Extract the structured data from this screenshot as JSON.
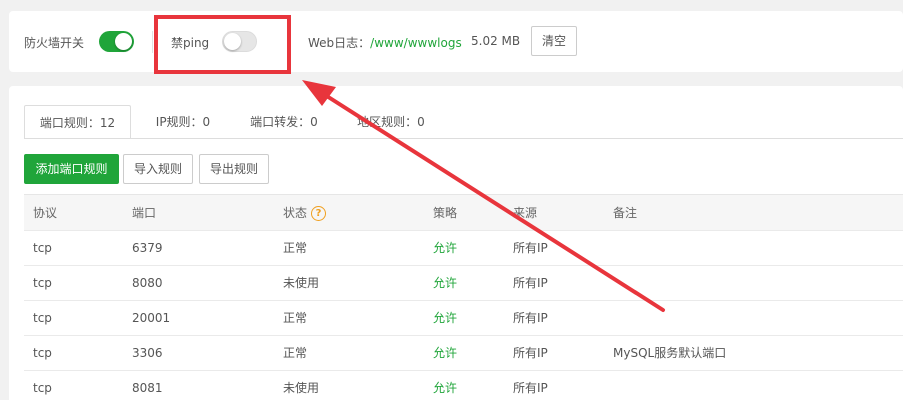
{
  "firewall": {
    "label": "防火墙开关",
    "on": true
  },
  "ping": {
    "label": "禁ping",
    "on": false
  },
  "weblog": {
    "label": "Web日志：",
    "path": "/www/wwwlogs",
    "size": "5.02 MB",
    "clear_label": "清空"
  },
  "tabs": [
    {
      "label": "端口规则：12",
      "active": true
    },
    {
      "label": "IP规则：0",
      "active": false
    },
    {
      "label": "端口转发：0",
      "active": false
    },
    {
      "label": "地区规则：0",
      "active": false
    }
  ],
  "actions": {
    "add_label": "添加端口规则",
    "import_label": "导入规则",
    "export_label": "导出规则"
  },
  "table": {
    "headers": {
      "protocol": "协议",
      "port": "端口",
      "status": "状态",
      "policy": "策略",
      "source": "来源",
      "remark": "备注"
    },
    "rows": [
      {
        "protocol": "tcp",
        "port": "6379",
        "status": "正常",
        "policy": "允许",
        "source": "所有IP",
        "remark": ""
      },
      {
        "protocol": "tcp",
        "port": "8080",
        "status": "未使用",
        "policy": "允许",
        "source": "所有IP",
        "remark": ""
      },
      {
        "protocol": "tcp",
        "port": "20001",
        "status": "正常",
        "policy": "允许",
        "source": "所有IP",
        "remark": ""
      },
      {
        "protocol": "tcp",
        "port": "3306",
        "status": "正常",
        "policy": "允许",
        "source": "所有IP",
        "remark": "MySQL服务默认端口"
      },
      {
        "protocol": "tcp",
        "port": "8081",
        "status": "未使用",
        "policy": "允许",
        "source": "所有IP",
        "remark": ""
      }
    ]
  },
  "colors": {
    "accent": "#20a53a",
    "annotation": "#e8353c",
    "help_icon": "#f0a020"
  }
}
